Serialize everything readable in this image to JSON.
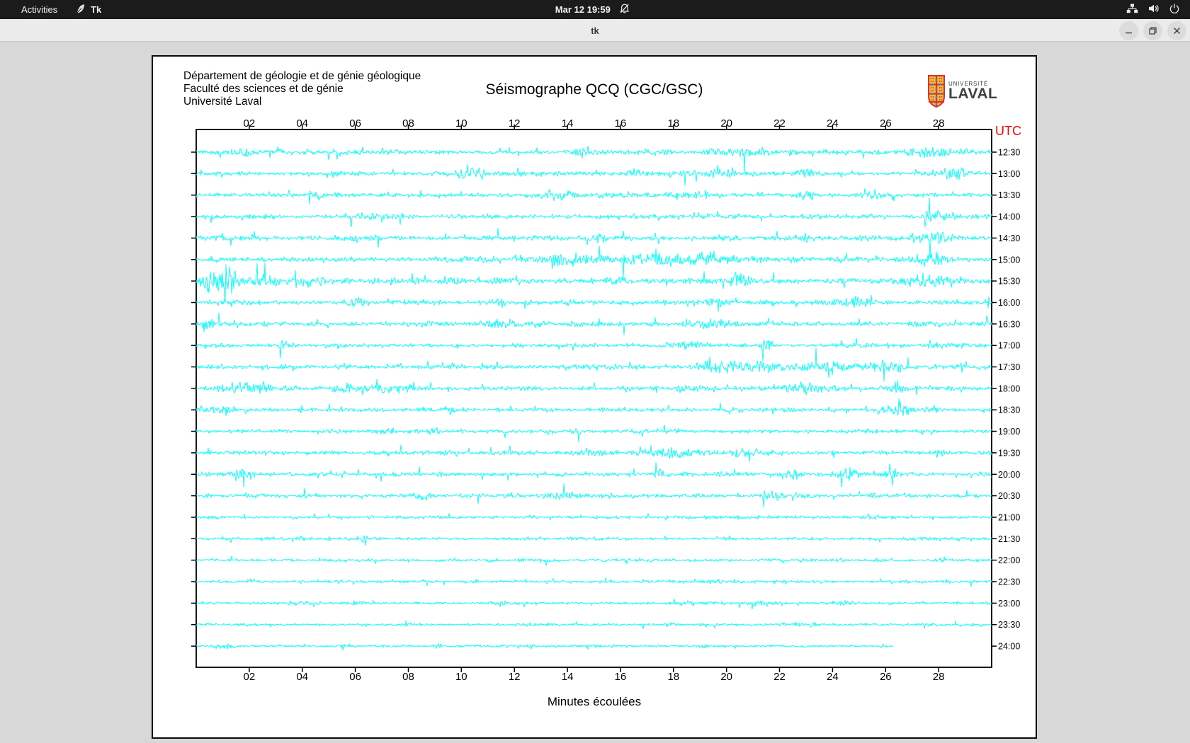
{
  "os_bar": {
    "activities": "Activities",
    "app_name": "Tk",
    "clock": "Mar 12  19:59",
    "tray_icons": [
      "network-icon",
      "volume-icon",
      "power-icon"
    ]
  },
  "titlebar": {
    "title": "tk"
  },
  "canvas": {
    "header_lines": [
      "Département de géologie et de génie géologique",
      "Faculté des sciences et de génie",
      "Université Laval"
    ],
    "title": "Séismographe QCQ (CGC/GSC)",
    "logo": {
      "line1": "UNIVERSITÉ",
      "line2": "LAVAL"
    },
    "xlabel": "Minutes écoulées"
  },
  "chart_data": {
    "type": "line",
    "title": "Séismographe QCQ (CGC/GSC)",
    "xlabel": "Minutes écoulées",
    "utc_label": "UTC",
    "x_range": [
      0,
      30
    ],
    "x_ticks": [
      "02",
      "04",
      "06",
      "08",
      "10",
      "12",
      "14",
      "16",
      "18",
      "20",
      "22",
      "24",
      "26",
      "28"
    ],
    "colors": {
      "trace": "#00FFFF",
      "utc_text": "#FF0000",
      "frame": "#000000",
      "background": "#FFFFFF"
    },
    "rows": [
      {
        "time": "12:30",
        "amp": 3.4,
        "bursts": [
          [
            1.5,
            0.6,
            6
          ],
          [
            14.5,
            0.3,
            5
          ],
          [
            21,
            1.5,
            4
          ],
          [
            27.6,
            0.8,
            7
          ]
        ]
      },
      {
        "time": "13:00",
        "amp": 3.0,
        "bursts": [
          [
            5,
            0.2,
            5
          ],
          [
            10.3,
            0.5,
            9
          ],
          [
            16.5,
            0.3,
            6
          ],
          [
            19.5,
            1.2,
            5
          ],
          [
            23,
            0.4,
            6
          ],
          [
            28.6,
            0.6,
            8
          ]
        ]
      },
      {
        "time": "13:30",
        "amp": 3.0,
        "bursts": [
          [
            13.5,
            0.8,
            5
          ],
          [
            19,
            0.5,
            5
          ],
          [
            23,
            0.3,
            6
          ],
          [
            25.5,
            0.3,
            6
          ]
        ]
      },
      {
        "time": "14:00",
        "amp": 3.0,
        "bursts": [
          [
            7,
            0.5,
            5
          ],
          [
            27.9,
            0.5,
            9
          ]
        ]
      },
      {
        "time": "14:30",
        "amp": 3.4,
        "bursts": [
          [
            1,
            0.3,
            5
          ],
          [
            15,
            0.5,
            4
          ],
          [
            23,
            0.5,
            5
          ],
          [
            27.6,
            0.9,
            8
          ]
        ]
      },
      {
        "time": "15:00",
        "amp": 3.9,
        "bursts": [
          [
            14,
            1,
            6
          ],
          [
            17,
            2,
            5
          ],
          [
            19,
            1.5,
            7
          ],
          [
            27.8,
            0.5,
            12
          ]
        ]
      },
      {
        "time": "15:30",
        "amp": 4.4,
        "bursts": [
          [
            0.7,
            0.6,
            14
          ],
          [
            1.2,
            0.35,
            19
          ],
          [
            2.6,
            0.5,
            8
          ],
          [
            4.1,
            0.6,
            7
          ],
          [
            20.5,
            0.4,
            9
          ],
          [
            27.5,
            0.8,
            10
          ]
        ]
      },
      {
        "time": "16:00",
        "amp": 3.4,
        "bursts": [
          [
            6,
            0.3,
            6
          ],
          [
            11.5,
            0.4,
            6
          ],
          [
            19.7,
            0.3,
            7
          ],
          [
            25,
            0.4,
            7
          ]
        ]
      },
      {
        "time": "16:30",
        "amp": 3.4,
        "bursts": [
          [
            0.5,
            0.5,
            6
          ],
          [
            11.5,
            0.5,
            5
          ],
          [
            19.5,
            0.8,
            6
          ]
        ]
      },
      {
        "time": "17:00",
        "amp": 2.8,
        "bursts": [
          [
            3.3,
            0.2,
            6
          ],
          [
            18.5,
            0.6,
            5
          ],
          [
            21.5,
            0.25,
            13
          ]
        ]
      },
      {
        "time": "17:30",
        "amp": 3.2,
        "bursts": [
          [
            19.6,
            0.6,
            8
          ],
          [
            21,
            1,
            7
          ],
          [
            23.5,
            1.5,
            6
          ],
          [
            26,
            0.8,
            6
          ]
        ]
      },
      {
        "time": "18:00",
        "amp": 3.2,
        "bursts": [
          [
            1.8,
            0.8,
            8
          ],
          [
            5.5,
            0.4,
            7
          ],
          [
            7.1,
            0.3,
            6
          ],
          [
            23,
            0.8,
            9
          ],
          [
            26.5,
            0.5,
            5
          ]
        ]
      },
      {
        "time": "18:30",
        "amp": 3.0,
        "bursts": [
          [
            1,
            0.5,
            6
          ],
          [
            26.6,
            0.7,
            7
          ]
        ]
      },
      {
        "time": "19:00",
        "amp": 2.8,
        "bursts": [
          [
            7,
            0.3,
            4
          ],
          [
            9,
            0.3,
            4
          ],
          [
            18,
            0.3,
            4
          ]
        ]
      },
      {
        "time": "19:30",
        "amp": 3.0,
        "bursts": [
          [
            15,
            0.6,
            5
          ],
          [
            18,
            1.2,
            5
          ],
          [
            20.6,
            0.4,
            6
          ]
        ]
      },
      {
        "time": "20:00",
        "amp": 3.0,
        "bursts": [
          [
            1.8,
            0.4,
            8
          ],
          [
            17.5,
            0.3,
            7
          ],
          [
            22.5,
            0.4,
            7
          ],
          [
            24.6,
            0.5,
            7
          ],
          [
            26.1,
            0.3,
            6
          ]
        ]
      },
      {
        "time": "20:30",
        "amp": 2.8,
        "bursts": [
          [
            8.5,
            0.4,
            5
          ],
          [
            14,
            0.5,
            4
          ],
          [
            21.8,
            0.3,
            5
          ]
        ]
      },
      {
        "time": "21:00",
        "amp": 2.2,
        "bursts": []
      },
      {
        "time": "21:30",
        "amp": 2.2,
        "bursts": [
          [
            4,
            0.2,
            4
          ],
          [
            6.3,
            0.2,
            4
          ]
        ]
      },
      {
        "time": "22:00",
        "amp": 2.2,
        "bursts": [
          [
            13.3,
            0.3,
            4
          ]
        ]
      },
      {
        "time": "22:30",
        "amp": 2.2,
        "bursts": [
          [
            19.5,
            0.3,
            3
          ]
        ]
      },
      {
        "time": "23:00",
        "amp": 2.0,
        "bursts": [
          [
            6,
            0.2,
            3
          ],
          [
            24.5,
            0.3,
            4
          ]
        ]
      },
      {
        "time": "23:30",
        "amp": 2.0,
        "bursts": []
      },
      {
        "time": "24:00",
        "amp": 1.8,
        "bursts": [
          [
            1.2,
            0.3,
            5
          ],
          [
            9.2,
            0.2,
            3
          ],
          [
            14.8,
            0.2,
            3
          ]
        ],
        "end_minute": 26.3
      }
    ]
  }
}
